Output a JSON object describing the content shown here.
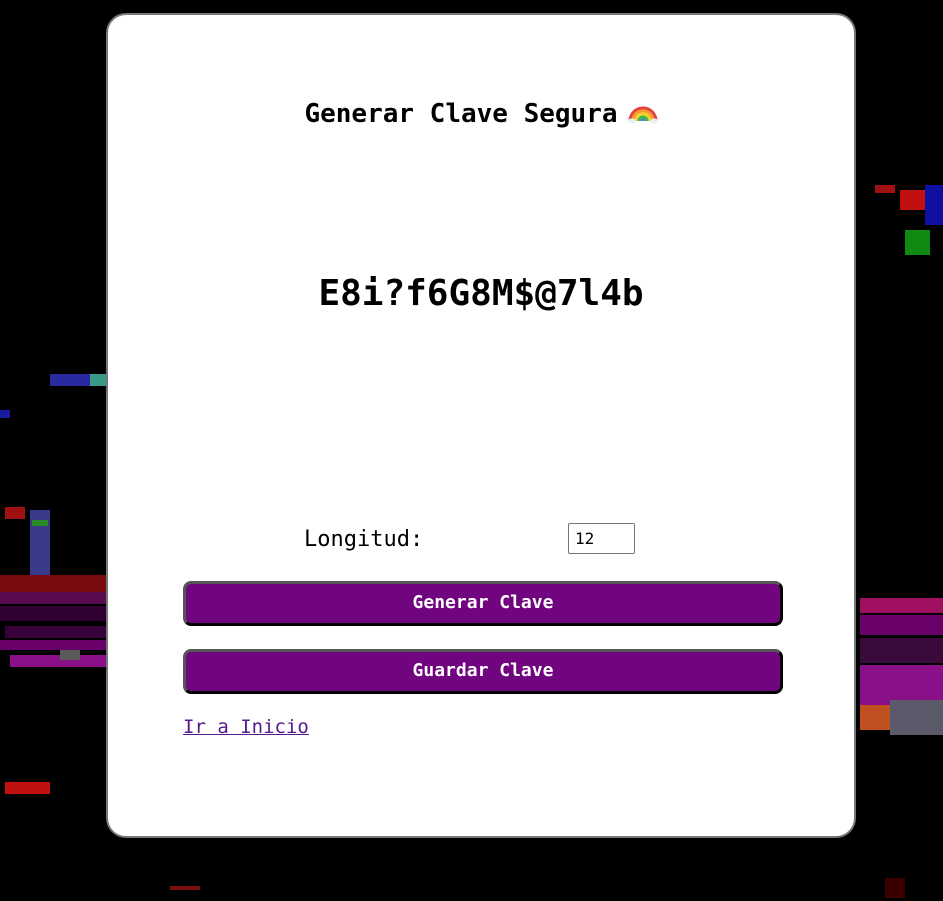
{
  "page": {
    "title": "Generar Clave Segura",
    "title_icon": "rainbow-icon"
  },
  "password": {
    "value": "E8i?f6G8M$@7l4b"
  },
  "length": {
    "label": "Longitud:",
    "value": "12"
  },
  "buttons": {
    "generate_label": "Generar Clave",
    "save_label": "Guardar Clave"
  },
  "links": {
    "home_label": "Ir a Inicio"
  },
  "colors": {
    "button_bg": "#71057f",
    "link": "#551a8b",
    "background": "#000000",
    "card": "#ffffff"
  }
}
